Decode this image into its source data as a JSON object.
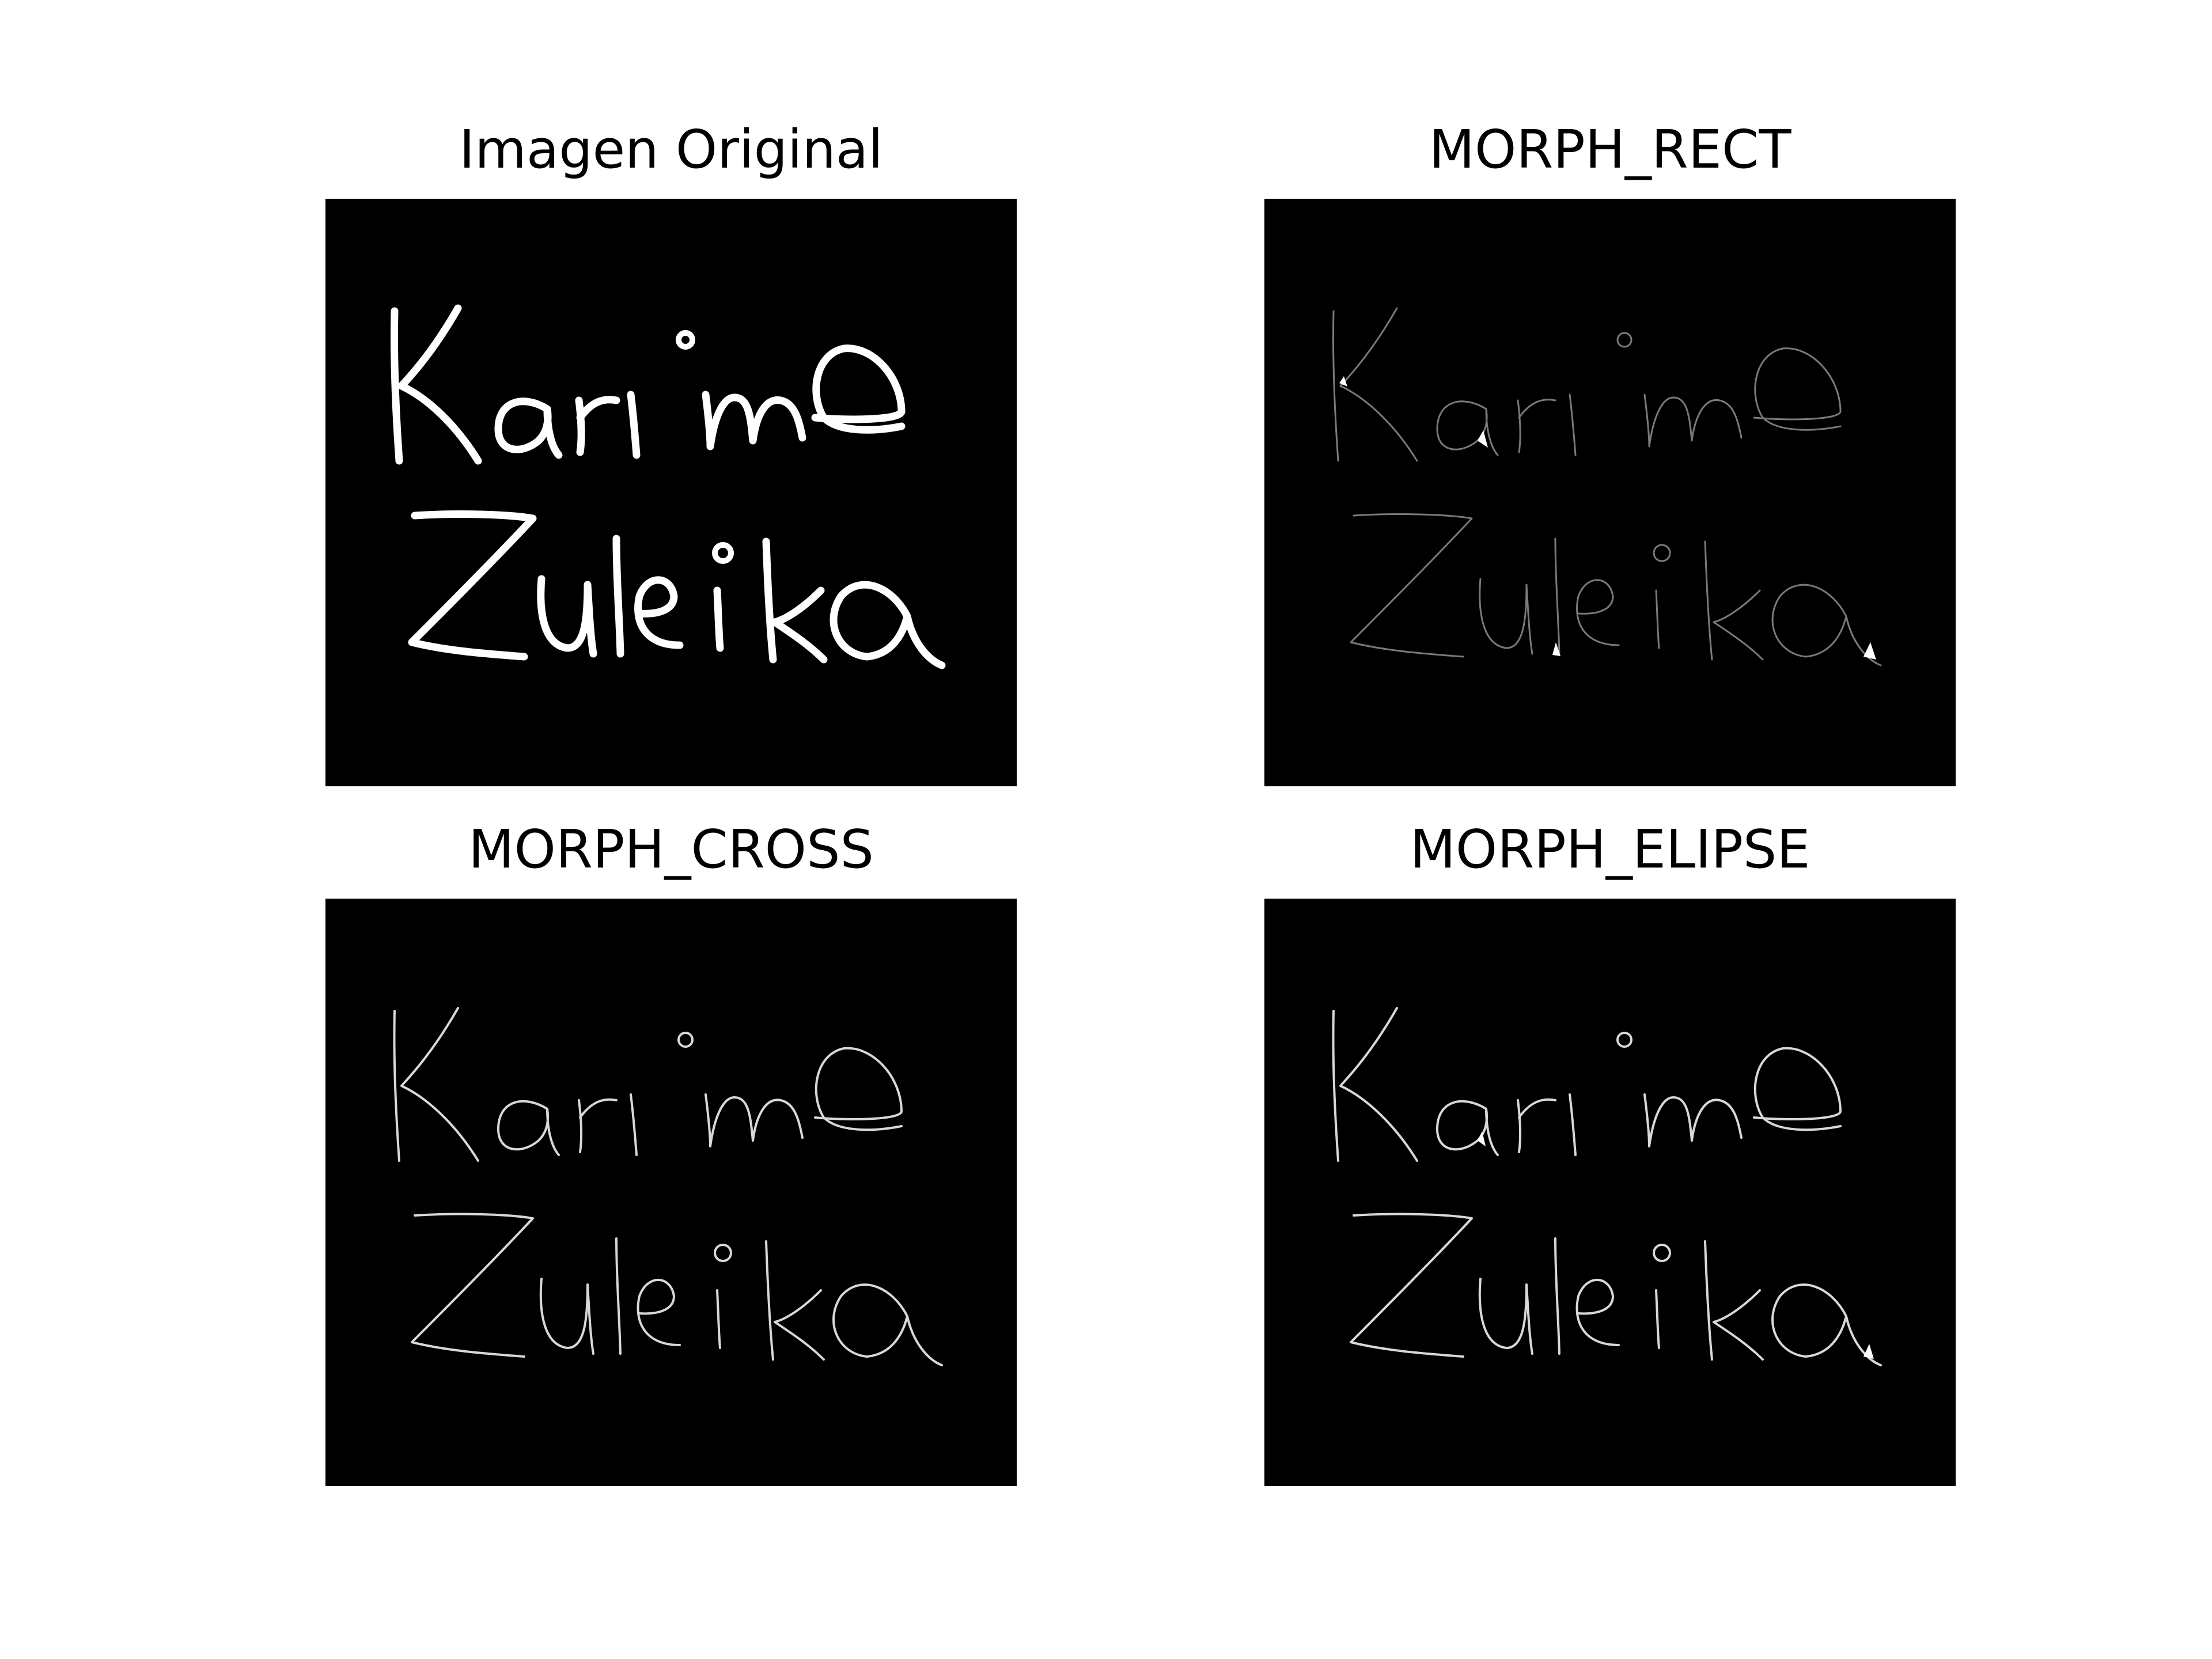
{
  "figure": {
    "background_color": "#ffffff",
    "image_background_color": "#000000",
    "stroke_color": "#ffffff"
  },
  "panels": [
    {
      "title": "Imagen Original",
      "handwriting": [
        "Karime",
        "Zuleika"
      ],
      "stroke_style": "thick"
    },
    {
      "title": "MORPH_RECT",
      "handwriting": [
        "Karime",
        "Zuleika"
      ],
      "stroke_style": "faint-outline"
    },
    {
      "title": "MORPH_CROSS",
      "handwriting": [
        "Karime",
        "Zuleika"
      ],
      "stroke_style": "thin-outline"
    },
    {
      "title": "MORPH_ELIPSE",
      "handwriting": [
        "Karime",
        "Zuleika"
      ],
      "stroke_style": "thin-outline"
    }
  ]
}
